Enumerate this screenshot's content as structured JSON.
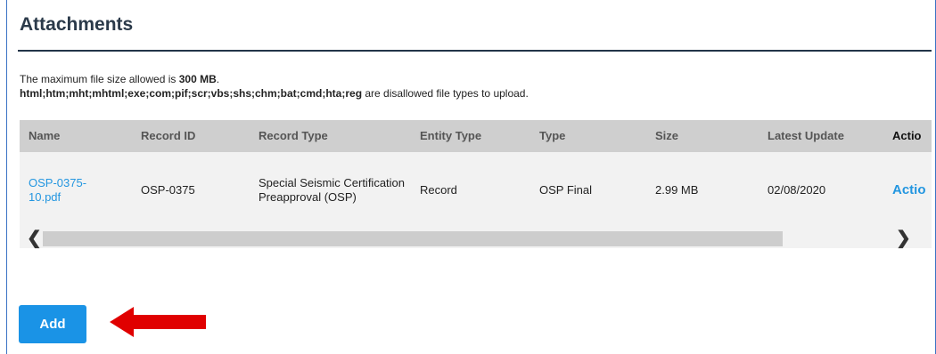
{
  "section": {
    "title": "Attachments"
  },
  "info": {
    "max_size_prefix": "The maximum file size allowed is ",
    "max_size_value": "300 MB",
    "max_size_suffix": ".",
    "disallowed_types": "html;htm;mht;mhtml;exe;com;pif;scr;vbs;shs;chm;bat;cmd;hta;reg",
    "disallowed_suffix": " are disallowed file types to upload."
  },
  "table": {
    "columns": [
      "Name",
      "Record ID",
      "Record Type",
      "Entity Type",
      "Type",
      "Size",
      "Latest Update",
      "Actio"
    ],
    "rows": [
      {
        "name": "OSP-0375-10.pdf",
        "record_id": "OSP-0375",
        "record_type": "Special Seismic Certification Preapproval (OSP)",
        "entity_type": "Record",
        "type": "OSP Final",
        "size": "2.99 MB",
        "latest_update": "02/08/2020",
        "action": "Actio"
      }
    ]
  },
  "scrollbar": {
    "left_icon": "chevron-left-icon",
    "right_icon": "chevron-right-icon"
  },
  "buttons": {
    "add_label": "Add"
  },
  "annotation": {
    "arrow_color": "#e00000",
    "icon": "red-arrow-left-icon"
  }
}
